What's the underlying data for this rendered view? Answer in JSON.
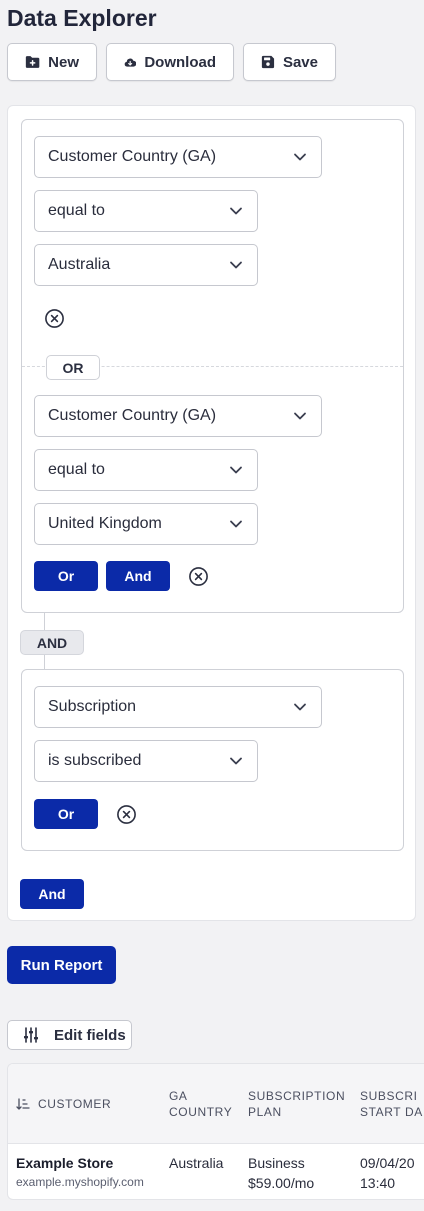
{
  "page": {
    "title": "Data Explorer"
  },
  "toolbar": {
    "new_label": "New",
    "download_label": "Download",
    "save_label": "Save"
  },
  "filters": {
    "group1": {
      "cond1": {
        "field": "Customer Country (GA)",
        "operator": "equal to",
        "value": "Australia"
      },
      "or_label": "OR",
      "cond2": {
        "field": "Customer Country (GA)",
        "operator": "equal to",
        "value": "United Kingdom"
      },
      "or_button": "Or",
      "and_button": "And"
    },
    "and_label": "AND",
    "group2": {
      "cond1": {
        "field": "Subscription",
        "operator": "is subscribed"
      },
      "or_button": "Or"
    },
    "add_and_button": "And"
  },
  "run_report_label": "Run Report",
  "edit_fields_label": "Edit fields",
  "table": {
    "columns": {
      "customer": "Customer",
      "country": [
        "GA",
        "Country"
      ],
      "plan": [
        "Subscription",
        "Plan"
      ],
      "start": [
        "Subscri",
        "Start Da"
      ]
    },
    "rows": [
      {
        "name": "Example Store",
        "domain": "example.myshopify.com",
        "country": "Australia",
        "plan": [
          "Business",
          "$59.00/mo"
        ],
        "start": [
          "09/04/20",
          "13:40"
        ]
      }
    ]
  },
  "colors": {
    "primary": "#0b2aa8",
    "border": "#c6c8cf",
    "background": "#f2f2f4"
  },
  "icons": [
    "file-plus-icon",
    "cloud-download-icon",
    "save-icon",
    "chevron-down-icon",
    "remove-circle-icon",
    "sliders-icon",
    "sort-icon"
  ]
}
